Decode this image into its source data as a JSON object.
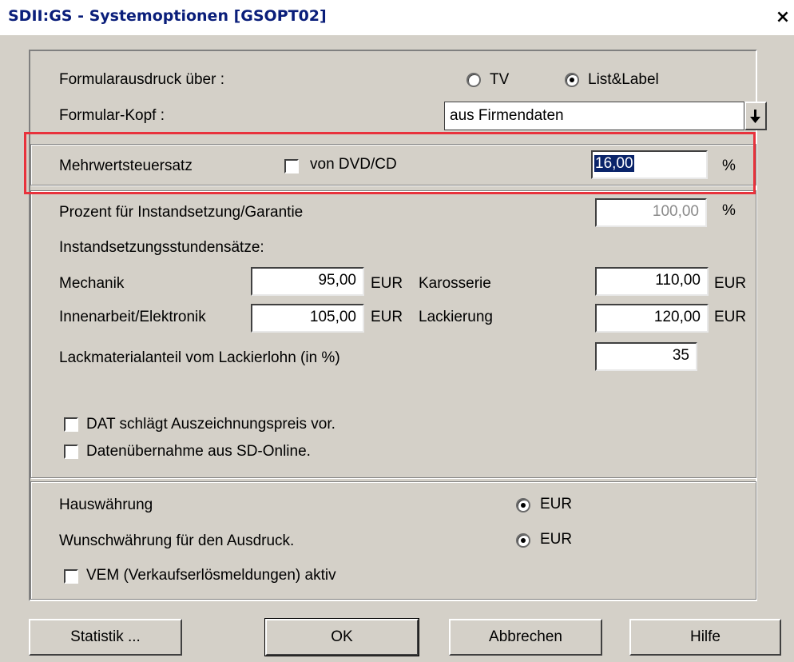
{
  "window": {
    "title": "SDII:GS - Systemoptionen [GSOPT02]",
    "close": "×"
  },
  "form_output": {
    "label": "Formularausdruck über :",
    "options": [
      {
        "label": "TV",
        "selected": false
      },
      {
        "label": "List&Label",
        "selected": true
      }
    ]
  },
  "form_header": {
    "label": "Formular-Kopf :",
    "value": "aus Firmendaten",
    "dropdown_icon": "arrow-down-icon"
  },
  "vat": {
    "label": "Mehrwertsteuersatz",
    "checkbox_label": "von DVD/CD",
    "checked": false,
    "value": "16,00",
    "unit": "%"
  },
  "repair": {
    "percent_label": "Prozent für Instandsetzung/Garantie",
    "percent_value": "100,00",
    "percent_unit": "%",
    "rates_label": "Instandsetzungsstundensätze:",
    "rates": [
      {
        "label": "Mechanik",
        "value": "95,00",
        "unit": "EUR"
      },
      {
        "label": "Karosserie",
        "value": "110,00",
        "unit": "EUR"
      },
      {
        "label": "Innenarbeit/Elektronik",
        "value": "105,00",
        "unit": "EUR"
      },
      {
        "label": "Lackierung",
        "value": "120,00",
        "unit": "EUR"
      }
    ],
    "paint_label": "Lackmaterialanteil vom Lackierlohn (in %)",
    "paint_value": "35",
    "checkboxes": [
      {
        "label": "DAT schlägt Auszeichnungspreis vor.",
        "checked": false
      },
      {
        "label": "Datenübernahme aus SD-Online.",
        "checked": false
      }
    ]
  },
  "currency": {
    "home_label": "Hauswährung",
    "home_value": "EUR",
    "print_label": "Wunschwährung für den Ausdruck.",
    "print_value": "EUR",
    "vem_label": "VEM (Verkaufserlösmeldungen) aktiv",
    "vem_checked": false
  },
  "buttons": {
    "statistik": "Statistik ...",
    "ok": "OK",
    "cancel": "Abbrechen",
    "help": "Hilfe"
  },
  "colors": {
    "title_text": "#0a1e7a",
    "highlight_box": "#e8323c",
    "selection": "#0a246a",
    "face": "#d4d0c8"
  }
}
